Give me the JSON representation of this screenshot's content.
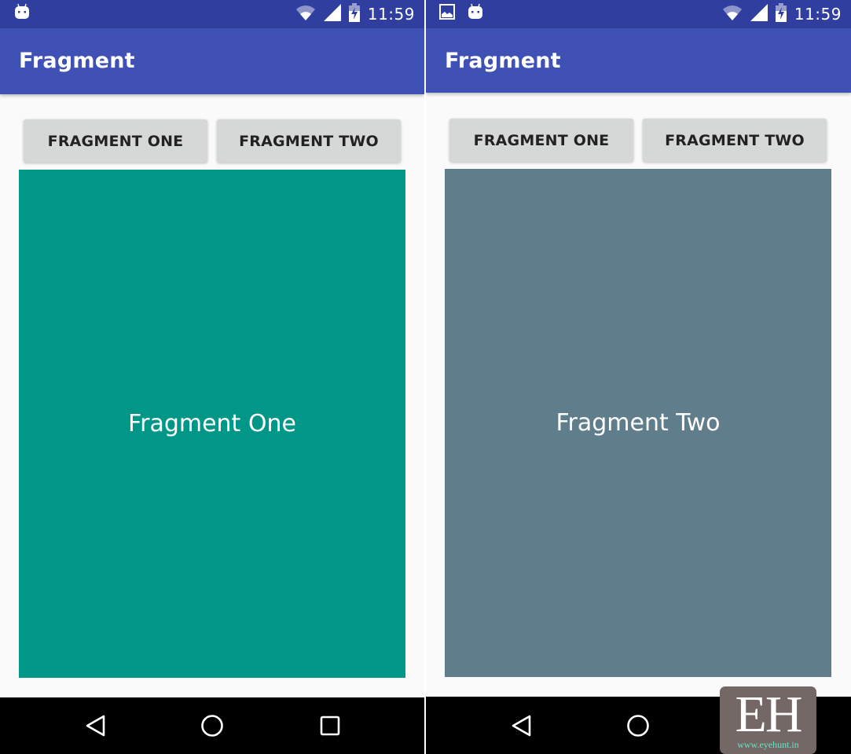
{
  "colors": {
    "status_bar": "#303f9f",
    "app_bar": "#3f51b5",
    "background": "#fafafa",
    "button": "#d6d7d7",
    "fragment_one": "#009688",
    "fragment_two": "#607d8b",
    "nav_bar": "#000000"
  },
  "screens": [
    {
      "status_bar": {
        "left_icons": [
          "android-notification-icon"
        ],
        "right_icons": [
          "wifi-icon",
          "cell-signal-icon",
          "battery-charging-icon"
        ],
        "time": "11:59"
      },
      "app_bar": {
        "title": "Fragment"
      },
      "buttons": [
        {
          "label": "FRAGMENT ONE"
        },
        {
          "label": "FRAGMENT TWO"
        }
      ],
      "fragment": {
        "text": "Fragment One",
        "color": "#009688"
      },
      "nav_bar": {
        "buttons": [
          "back",
          "home",
          "recents"
        ]
      }
    },
    {
      "status_bar": {
        "left_icons": [
          "image-notification-icon",
          "android-notification-icon"
        ],
        "right_icons": [
          "wifi-icon",
          "cell-signal-icon",
          "battery-charging-icon"
        ],
        "time": "11:59"
      },
      "app_bar": {
        "title": "Fragment"
      },
      "buttons": [
        {
          "label": "FRAGMENT ONE"
        },
        {
          "label": "FRAGMENT TWO"
        }
      ],
      "fragment": {
        "text": "Fragment Two",
        "color": "#607d8b"
      },
      "nav_bar": {
        "buttons": [
          "back",
          "home",
          "recents"
        ]
      }
    }
  ],
  "watermark": {
    "logo": "EH",
    "url": "www.eyehunt.in"
  }
}
